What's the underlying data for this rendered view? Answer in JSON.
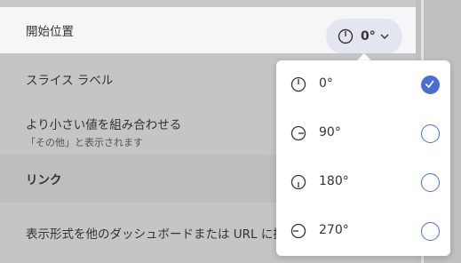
{
  "settings": {
    "start_position_label": "開始位置",
    "start_position_value": "0°",
    "slice_label": "スライス ラベル",
    "combine_label": "より小さい値を組み合わせる",
    "combine_sublabel": "「その他」と表示されます",
    "link_heading": "リンク",
    "link_row_label": "表示形式を他のダッシュボードまたは URL に接続"
  },
  "menu": {
    "options": [
      {
        "label": "0°",
        "icon": "clock-0-icon",
        "selected": true
      },
      {
        "label": "90°",
        "icon": "clock-90-icon",
        "selected": false
      },
      {
        "label": "180°",
        "icon": "clock-180-icon",
        "selected": false
      },
      {
        "label": "270°",
        "icon": "clock-270-icon",
        "selected": false
      }
    ]
  },
  "colors": {
    "accent": "#4b6fd0",
    "pill_bg": "#e3e6ee",
    "overlay_bg": "#c9c9c9"
  }
}
